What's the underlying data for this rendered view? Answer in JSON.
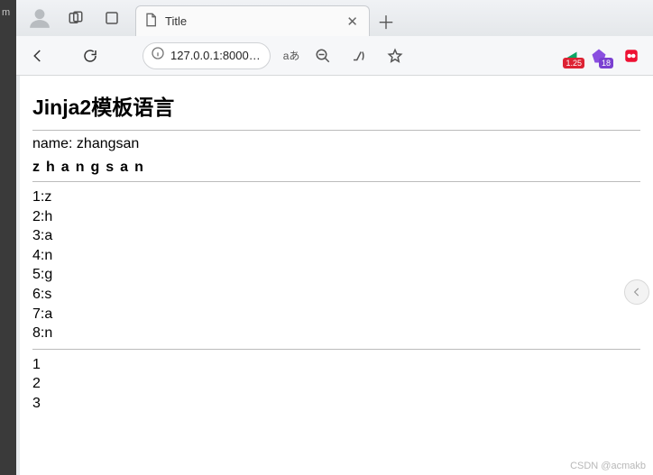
{
  "left_strip": {
    "label": "m"
  },
  "tab": {
    "title": "Title"
  },
  "toolbar": {
    "url": "127.0.0.1:8000…",
    "lang_badge": "aあ",
    "ext1_badge": "1.25",
    "ext2_badge": "18"
  },
  "content": {
    "heading": "Jinja2模板语言",
    "name_label": "name:",
    "name_value": "zhangsan",
    "letters": [
      "z",
      "h",
      "a",
      "n",
      "g",
      "s",
      "a",
      "n"
    ],
    "enumerated": [
      "1:z",
      "2:h",
      "3:a",
      "4:n",
      "5:g",
      "6:s",
      "7:a",
      "8:n"
    ],
    "numbers": [
      "1",
      "2",
      "3"
    ]
  },
  "watermark": "CSDN @acmakb"
}
